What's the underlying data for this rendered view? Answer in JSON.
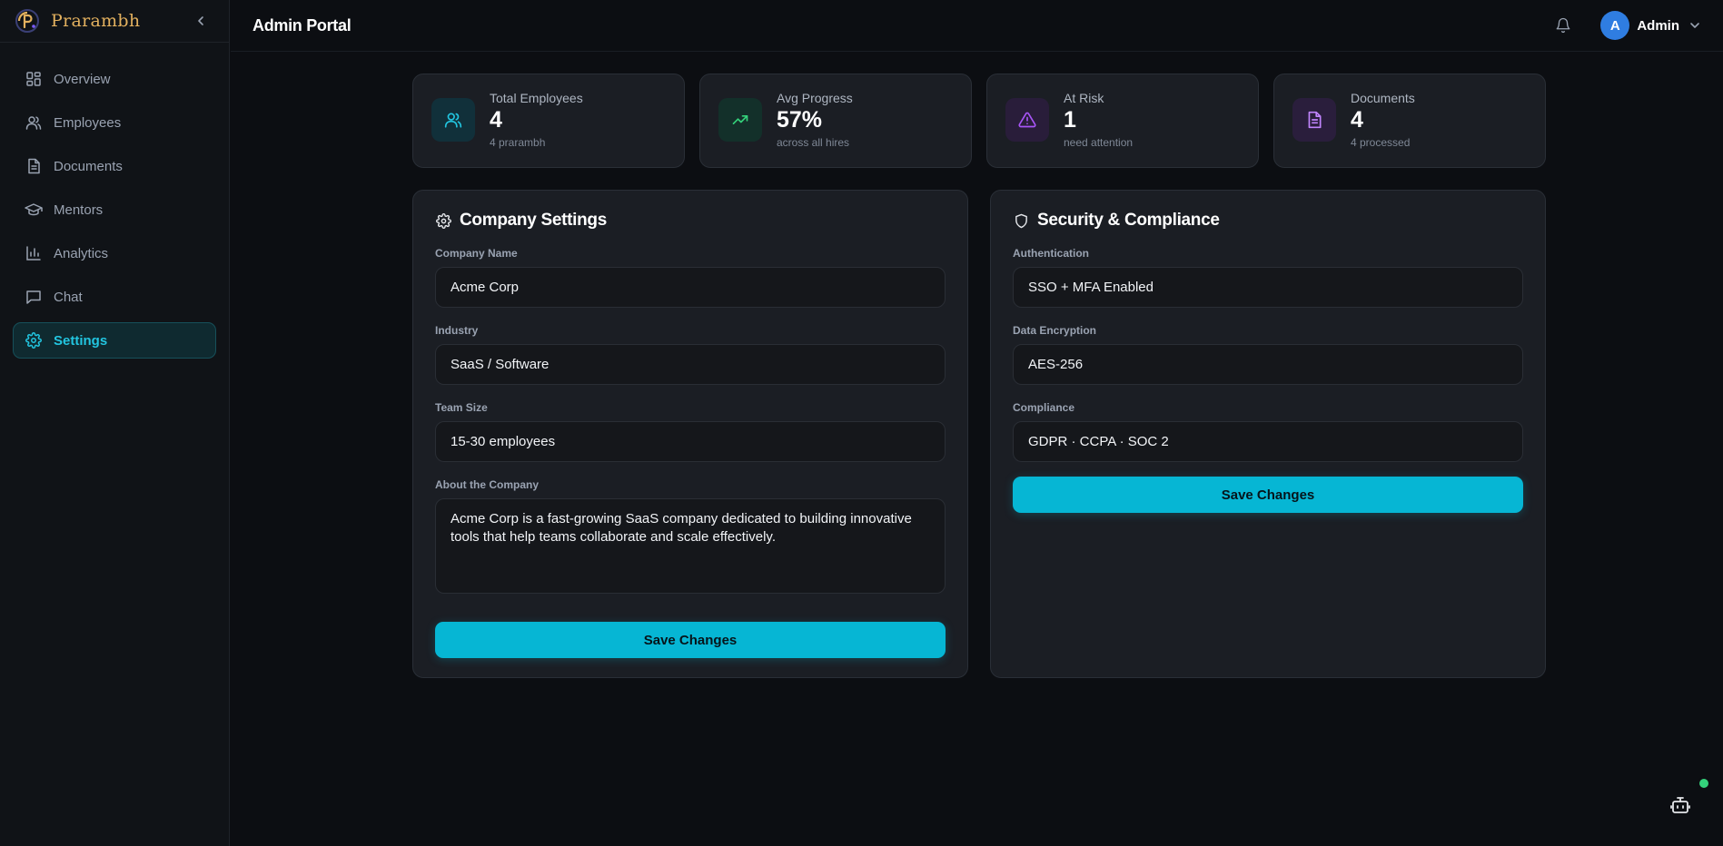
{
  "brand": {
    "name": "Prarambh"
  },
  "sidebar": {
    "items": [
      {
        "label": "Overview",
        "icon": "grid-icon"
      },
      {
        "label": "Employees",
        "icon": "users-icon"
      },
      {
        "label": "Documents",
        "icon": "file-icon"
      },
      {
        "label": "Mentors",
        "icon": "graduation-cap-icon"
      },
      {
        "label": "Analytics",
        "icon": "bar-chart-icon"
      },
      {
        "label": "Chat",
        "icon": "message-icon"
      },
      {
        "label": "Settings",
        "icon": "gear-icon",
        "active": true
      }
    ]
  },
  "header": {
    "title": "Admin Portal",
    "user": {
      "initial": "A",
      "name": "Admin"
    }
  },
  "stats": [
    {
      "label": "Total Employees",
      "value": "4",
      "sub": "4 prarambh",
      "icon": "users-icon",
      "color": "#22c5e0"
    },
    {
      "label": "Avg Progress",
      "value": "57%",
      "sub": "across all hires",
      "icon": "trending-up-icon",
      "color": "#34d27b"
    },
    {
      "label": "At Risk",
      "value": "1",
      "sub": "need attention",
      "icon": "alert-triangle-icon",
      "color": "#a855f7"
    },
    {
      "label": "Documents",
      "value": "4",
      "sub": "4 processed",
      "icon": "file-icon",
      "color": "#c084fc"
    }
  ],
  "company": {
    "title": "Company Settings",
    "name_label": "Company Name",
    "name_value": "Acme Corp",
    "industry_label": "Industry",
    "industry_value": "SaaS / Software",
    "team_label": "Team Size",
    "team_value": "15-30 employees",
    "about_label": "About the Company",
    "about_value": "Acme Corp is a fast-growing SaaS company dedicated to building innovative tools that help teams collaborate and scale effectively.",
    "save_label": "Save Changes"
  },
  "security": {
    "title": "Security & Compliance",
    "auth_label": "Authentication",
    "auth_value": "SSO + MFA Enabled",
    "enc_label": "Data Encryption",
    "enc_value": "AES-256",
    "compliance_label": "Compliance",
    "compliance_value": "GDPR · CCPA · SOC 2",
    "save_label": "Save Changes"
  },
  "colors": {
    "accent": "#06b6d4",
    "brand": "#e3b15f",
    "online": "#34d27b"
  }
}
